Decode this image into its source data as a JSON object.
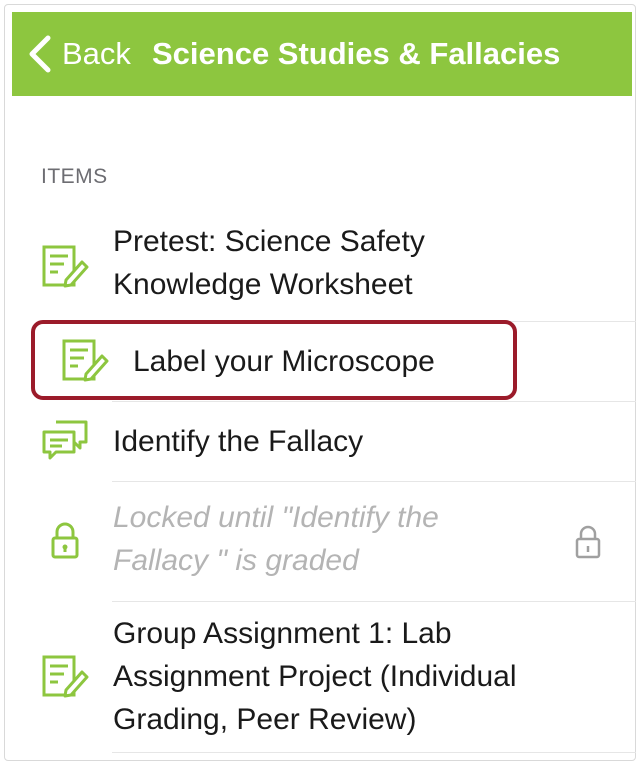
{
  "nav": {
    "back_label": "Back",
    "title": "Science Studies & Fallacies",
    "bar_color": "#8dc63f"
  },
  "section": {
    "header": "ITEMS"
  },
  "items": [
    {
      "label_line1": "Pretest: Science Safety",
      "label_line2": "Knowledge Worksheet",
      "icon": "assignment-icon"
    },
    {
      "label": "Label your Microscope",
      "icon": "assignment-icon",
      "highlighted": true
    },
    {
      "label": "Identify the Fallacy",
      "icon": "discussion-icon"
    },
    {
      "label_line1": "Locked until \"Identify the",
      "label_line2": "Fallacy \" is graded",
      "icon": "lock-icon",
      "locked": true
    },
    {
      "label_line1": "Group Assignment 1: Lab",
      "label_line2": "Assignment Project (Individual",
      "label_line3": "Grading, Peer Review)",
      "icon": "assignment-icon"
    }
  ],
  "colors": {
    "accent_green": "#8dc63f",
    "highlight_border": "#9b1b2a",
    "locked_text": "#b4b4b4"
  }
}
